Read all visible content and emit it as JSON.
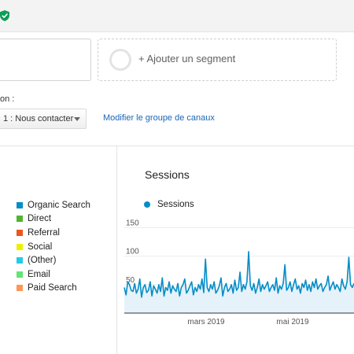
{
  "header": {
    "shield_icon": "shield-check-icon",
    "shield_color": "#0f9d58"
  },
  "segments": {
    "add_label": "+ Ajouter un segment"
  },
  "channel_group": {
    "field_label": "on :",
    "selected": "1 : Nous contacter",
    "modify_link": "Modifier le groupe de canaux"
  },
  "legend": {
    "items": [
      {
        "label": "Organic Search",
        "color": "#058dc7"
      },
      {
        "label": "Direct",
        "color": "#50b432"
      },
      {
        "label": "Referral",
        "color": "#ed561b"
      },
      {
        "label": "Social",
        "color": "#edef00"
      },
      {
        "label": "(Other)",
        "color": "#24cbe5"
      },
      {
        "label": "Email",
        "color": "#64e572"
      },
      {
        "label": "Paid Search",
        "color": "#ff9655"
      }
    ]
  },
  "chart": {
    "title": "Sessions",
    "series_label": "Sessions",
    "series_color": "#058dc7"
  },
  "chart_data": {
    "type": "area",
    "title": "Sessions",
    "series": [
      {
        "name": "Sessions",
        "values": [
          45,
          32,
          55,
          50,
          40,
          38,
          52,
          35,
          42,
          60,
          28,
          45,
          50,
          36,
          40,
          55,
          30,
          48,
          42,
          35,
          50,
          38,
          62,
          30,
          45,
          40,
          55,
          35,
          48,
          42,
          38,
          52,
          30,
          45,
          50,
          60,
          35,
          40,
          48,
          55,
          32,
          45,
          38,
          50,
          42,
          60,
          36,
          95,
          45,
          38,
          50,
          42,
          55,
          35,
          40,
          48,
          62,
          30,
          45,
          52,
          38,
          42,
          50,
          35,
          58,
          40,
          45,
          72,
          38,
          50,
          42,
          55,
          108,
          48,
          40,
          52,
          35,
          45,
          60,
          38,
          50,
          42,
          48,
          55,
          38,
          45,
          50,
          40,
          62,
          35,
          48,
          42,
          52,
          85,
          40,
          45,
          55,
          38,
          50,
          60,
          42,
          48,
          35,
          52,
          45,
          58,
          40,
          50,
          38,
          55,
          45,
          60,
          42,
          48,
          52,
          38,
          45,
          50,
          65,
          40,
          48,
          55,
          42,
          50,
          45,
          38,
          60,
          48,
          42,
          55,
          98,
          50,
          45,
          52
        ]
      }
    ],
    "ylim": [
      0,
      170
    ],
    "yticks": [
      50,
      100,
      150
    ],
    "xlabels": [
      "mars 2019",
      "mai 2019"
    ],
    "grid": true
  }
}
